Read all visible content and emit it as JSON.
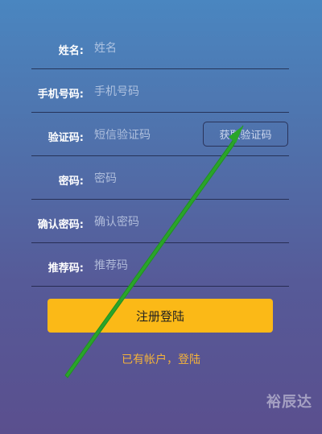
{
  "form": {
    "fields": [
      {
        "label": "姓名:",
        "placeholder": "姓名"
      },
      {
        "label": "手机号码:",
        "placeholder": "手机号码"
      },
      {
        "label": "验证码:",
        "placeholder": "短信验证码"
      },
      {
        "label": "密码:",
        "placeholder": "密码"
      },
      {
        "label": "确认密码:",
        "placeholder": "确认密码"
      },
      {
        "label": "推荐码:",
        "placeholder": "推荐码"
      }
    ],
    "get_code_label": "获取验证码",
    "submit_label": "注册登陆",
    "login_link": "已有帐户，登陆"
  },
  "watermark": "裕辰达",
  "colors": {
    "submit": "#fbb917",
    "link": "#f3b23a",
    "annotation_arrow": "#2aa52a"
  }
}
